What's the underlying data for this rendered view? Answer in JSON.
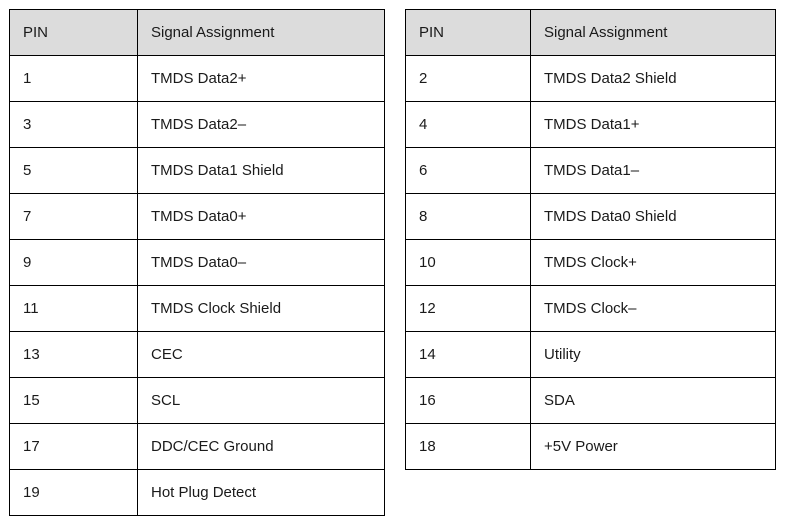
{
  "document": {
    "type": "hdmi-pinout-tables",
    "background_color": "#ffffff",
    "header_background_color": "#dcdcdc",
    "border_color": "#000000",
    "text_color": "#1a1a1a"
  },
  "tables": [
    {
      "id": "odd-pins",
      "columns": [
        {
          "key": "pin",
          "label": "PIN"
        },
        {
          "key": "signal",
          "label": "Signal Assignment"
        }
      ],
      "rows": [
        {
          "pin": "1",
          "signal": "TMDS Data2+"
        },
        {
          "pin": "3",
          "signal": "TMDS Data2–"
        },
        {
          "pin": "5",
          "signal": "TMDS Data1 Shield"
        },
        {
          "pin": "7",
          "signal": "TMDS Data0+"
        },
        {
          "pin": "9",
          "signal": "TMDS Data0–"
        },
        {
          "pin": "11",
          "signal": "TMDS Clock Shield"
        },
        {
          "pin": "13",
          "signal": "CEC"
        },
        {
          "pin": "15",
          "signal": "SCL"
        },
        {
          "pin": "17",
          "signal": "DDC/CEC Ground"
        },
        {
          "pin": "19",
          "signal": "Hot Plug Detect"
        }
      ]
    },
    {
      "id": "even-pins",
      "columns": [
        {
          "key": "pin",
          "label": "PIN"
        },
        {
          "key": "signal",
          "label": "Signal Assignment"
        }
      ],
      "rows": [
        {
          "pin": "2",
          "signal": "TMDS Data2 Shield"
        },
        {
          "pin": "4",
          "signal": "TMDS Data1+"
        },
        {
          "pin": "6",
          "signal": "TMDS Data1–"
        },
        {
          "pin": "8",
          "signal": "TMDS Data0 Shield"
        },
        {
          "pin": "10",
          "signal": "TMDS Clock+"
        },
        {
          "pin": "12",
          "signal": "TMDS Clock–"
        },
        {
          "pin": "14",
          "signal": "Utility"
        },
        {
          "pin": "16",
          "signal": "SDA"
        },
        {
          "pin": "18",
          "signal": "+5V Power"
        }
      ]
    }
  ]
}
